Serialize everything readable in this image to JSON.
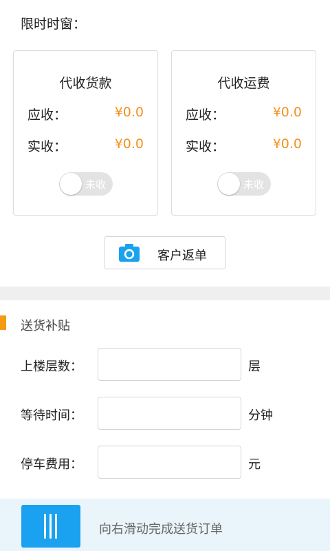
{
  "time_window": {
    "label": "限时时窗："
  },
  "cards": [
    {
      "title": "代收货款",
      "due_label": "应收：",
      "due_value": "¥0.0",
      "received_label": "实收：",
      "received_value": "¥0.0",
      "toggle_label": "未收"
    },
    {
      "title": "代收运费",
      "due_label": "应收：",
      "due_value": "¥0.0",
      "received_label": "实收：",
      "received_value": "¥0.0",
      "toggle_label": "未收"
    }
  ],
  "return_button": {
    "label": "客户返单",
    "icon": "camera-icon"
  },
  "subsidy": {
    "title": "送货补贴",
    "fields": [
      {
        "label": "上楼层数：",
        "value": "",
        "unit": "层"
      },
      {
        "label": "等待时间：",
        "value": "",
        "unit": "分钟"
      },
      {
        "label": "停车费用：",
        "value": "",
        "unit": "元"
      }
    ]
  },
  "slider": {
    "text": "向右滑动完成送货订单",
    "icon": "slide-handle-icon"
  },
  "colors": {
    "accent": "#1aa1f0",
    "amount": "#f5901e",
    "section_mark": "#f39c12"
  }
}
